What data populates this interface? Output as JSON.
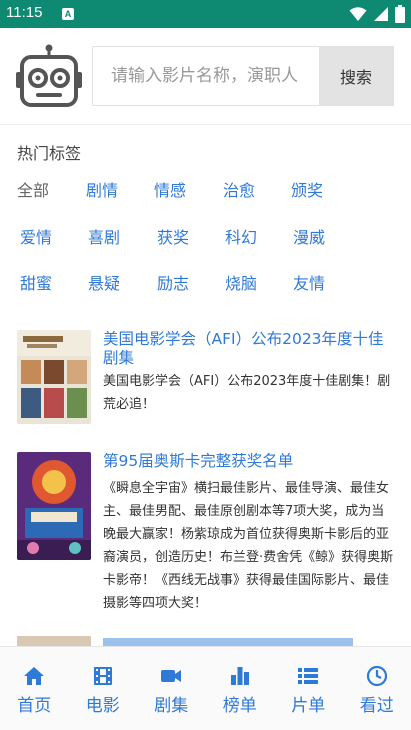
{
  "status_bar": {
    "time": "11:15",
    "notif": "A"
  },
  "search": {
    "placeholder": "请输入影片名称，演职人",
    "button_label": "搜索"
  },
  "tags": {
    "title": "热门标签",
    "rows": [
      [
        "全部",
        "剧情",
        "情感",
        "治愈",
        "颁奖"
      ],
      [
        "爱情",
        "喜剧",
        "获奖",
        "科幻",
        "漫威"
      ],
      [
        "甜蜜",
        "悬疑",
        "励志",
        "烧脑",
        "友情"
      ]
    ],
    "active": "全部"
  },
  "articles": [
    {
      "title": "美国电影学会（AFI）公布2023年度十佳剧集",
      "desc": "美国电影学会（AFI）公布2023年度十佳剧集！剧荒必追！"
    },
    {
      "title": "第95届奥斯卡完整获奖名单",
      "desc": "《瞬息全宇宙》横扫最佳影片、最佳导演、最佳女主、最佳男配、最佳原创剧本等7项大奖，成为当晚最大赢家！杨紫琼成为首位获得奥斯卡影后的亚裔演员，创造历史！布兰登·费舍凭《鲸》获得奥斯卡影帝！《西线无战事》获得最佳国际影片、最佳摄影等四项大奖！"
    }
  ],
  "tabbar": [
    {
      "label": "首页",
      "icon": "home-icon"
    },
    {
      "label": "电影",
      "icon": "film-icon"
    },
    {
      "label": "剧集",
      "icon": "video-camera-icon"
    },
    {
      "label": "榜单",
      "icon": "bar-chart-icon"
    },
    {
      "label": "片单",
      "icon": "list-icon"
    },
    {
      "label": "看过",
      "icon": "clock-icon"
    }
  ],
  "colors": {
    "status_bar": "#0f8a72",
    "accent": "#2f7ad6",
    "tab_bar_bg": "#fafafa"
  }
}
